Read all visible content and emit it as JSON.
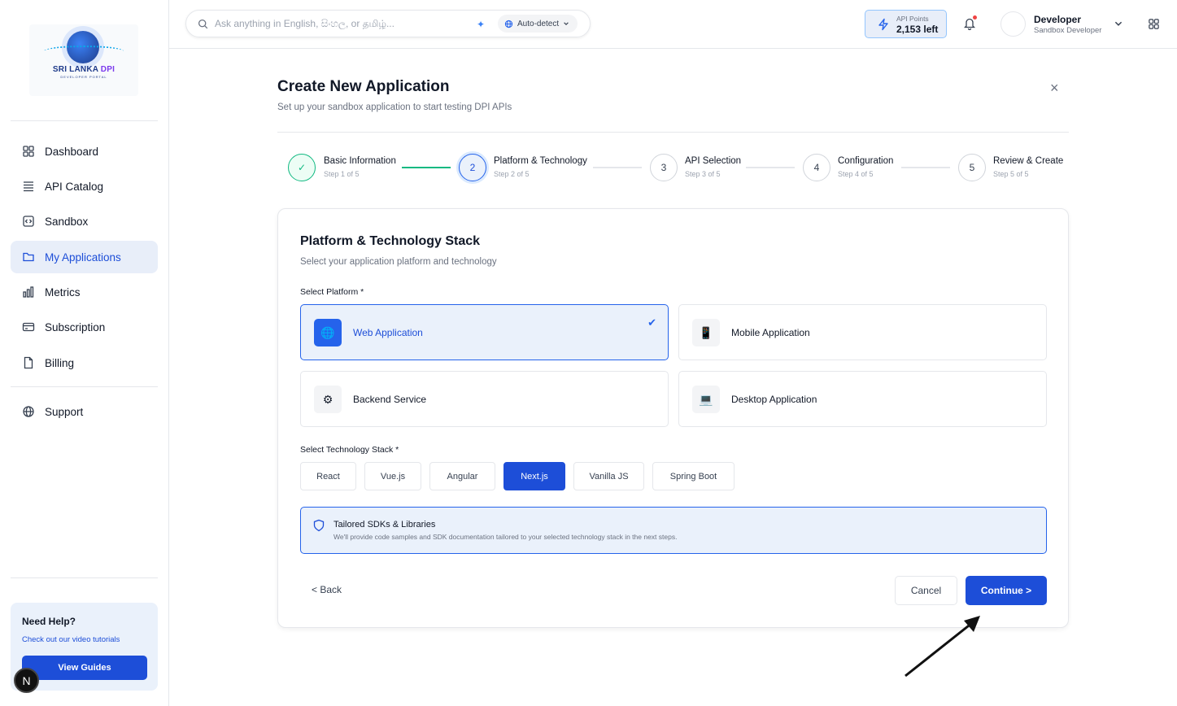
{
  "brand": {
    "wordmark_main": "SRI LANKA ",
    "wordmark_accent": "DPI",
    "wordmark_sub": "DEVELOPER PORTAL"
  },
  "sidebar": {
    "items": [
      {
        "label": "Dashboard",
        "icon": "grid-icon"
      },
      {
        "label": "API Catalog",
        "icon": "list-icon"
      },
      {
        "label": "Sandbox",
        "icon": "code-box-icon"
      },
      {
        "label": "My Applications",
        "icon": "folder-icon",
        "active": true
      },
      {
        "label": "Metrics",
        "icon": "bar-chart-icon"
      },
      {
        "label": "Subscription",
        "icon": "credit-card-icon"
      },
      {
        "label": "Billing",
        "icon": "document-icon"
      },
      {
        "label": "Support",
        "icon": "globe-icon"
      }
    ],
    "help": {
      "title": "Need Help?",
      "subtitle": "Check out our video tutorials",
      "button": "View Guides"
    },
    "badge": "N"
  },
  "topbar": {
    "search_placeholder": "Ask anything in English, සිංහල, or தமிழ்...",
    "language": "Auto-detect",
    "points_label": "API Points",
    "points_value": "2,153 left",
    "user_name": "Developer",
    "user_role": "Sandbox Developer"
  },
  "page": {
    "title": "Create New Application",
    "subtitle": "Set up your sandbox application to start testing DPI APIs",
    "close": "×"
  },
  "steps": [
    {
      "number": "✓",
      "name": "Basic Information",
      "sub": "Step 1 of 5",
      "state": "done"
    },
    {
      "number": "2",
      "name": "Platform & Technology",
      "sub": "Step 2 of 5",
      "state": "current"
    },
    {
      "number": "3",
      "name": "API Selection",
      "sub": "Step 3 of 5",
      "state": "pending"
    },
    {
      "number": "4",
      "name": "Configuration",
      "sub": "Step 4 of 5",
      "state": "pending"
    },
    {
      "number": "5",
      "name": "Review & Create",
      "sub": "Step 5 of 5",
      "state": "pending"
    }
  ],
  "form": {
    "title": "Platform & Technology Stack",
    "subtitle": "Select your application platform and technology",
    "platform_label": "Select Platform *",
    "platforms": [
      {
        "label": "Web Application",
        "icon": "🌐",
        "selected": true
      },
      {
        "label": "Mobile Application",
        "icon": "📱",
        "selected": false
      },
      {
        "label": "Backend Service",
        "icon": "⚙",
        "selected": false
      },
      {
        "label": "Desktop Application",
        "icon": "💻",
        "selected": false
      }
    ],
    "tech_label": "Select Technology Stack *",
    "techs": [
      {
        "label": "React",
        "selected": false
      },
      {
        "label": "Vue.js",
        "selected": false
      },
      {
        "label": "Angular",
        "selected": false
      },
      {
        "label": "Next.js",
        "selected": true
      },
      {
        "label": "Vanilla JS",
        "selected": false
      },
      {
        "label": "Spring Boot",
        "selected": false
      }
    ],
    "info_title": "Tailored SDKs & Libraries",
    "info_text": "We'll provide code samples and SDK documentation tailored to your selected technology stack in the next steps.",
    "back": "< Back",
    "cancel": "Cancel",
    "continue": "Continue >"
  },
  "colors": {
    "primary": "#1d4ed8",
    "success": "#10b981",
    "selected_bg": "#eaf1fb"
  }
}
